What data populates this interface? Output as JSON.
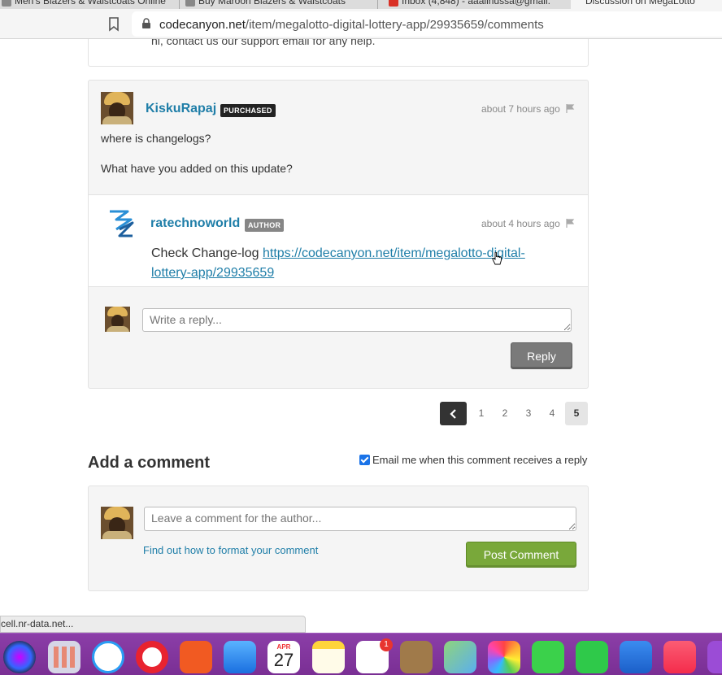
{
  "browser": {
    "tabs": [
      {
        "label": "Men's Blazers & Waistcoats Online"
      },
      {
        "label": "Buy Maroon Blazers & Waistcoats"
      },
      {
        "label": "Inbox (4,848) - aaalihussa@gmail."
      },
      {
        "label": "Discussion on MegaLotto"
      }
    ],
    "url_domain": "codecanyon.net",
    "url_path": "/item/megalotto-digital-lottery-app/29935659/comments"
  },
  "previous_comment": {
    "text": "hi, contact us our support email for any help."
  },
  "comment": {
    "username": "KiskuRapaj",
    "badge": "PURCHASED",
    "time": "about 7 hours ago",
    "line1": "where is changelogs?",
    "line2": "What have you added on this update?"
  },
  "reply": {
    "username": "ratechnoworld",
    "badge": "AUTHOR",
    "time": "about 4 hours ago",
    "text_prefix": "Check Change-log ",
    "link": "https://codecanyon.net/item/megalotto-digital-lottery-app/29935659"
  },
  "reply_form": {
    "placeholder": "Write a reply...",
    "button": "Reply"
  },
  "pagination": {
    "pages": [
      "1",
      "2",
      "3",
      "4",
      "5"
    ],
    "current": "5"
  },
  "add_comment": {
    "title": "Add a comment",
    "email_label": "Email me when this comment receives a reply",
    "email_checked": true,
    "placeholder": "Leave a comment for the author...",
    "format_link": "Find out how to format your comment",
    "post_button": "Post Comment"
  },
  "status_bar": {
    "text": "cell.nr-data.net..."
  },
  "dock": {
    "icons": [
      "siri-icon",
      "launchpad-icon",
      "safari-icon",
      "opera-icon",
      "brave-icon",
      "mail-icon",
      "calendar-icon",
      "notes-icon",
      "reminders-icon",
      "contacts-icon",
      "maps-icon",
      "photos-icon",
      "messages-icon",
      "facetime-icon",
      "keynote-icon",
      "music-icon",
      "podcasts-icon"
    ],
    "calendar_month": "APR",
    "calendar_day": "27",
    "reminders_badge": "1"
  },
  "colors": {
    "link": "#1f7ea8",
    "post_button": "#79a83a",
    "reply_button": "#7a7a7a",
    "dock": "#8b3ea8"
  }
}
